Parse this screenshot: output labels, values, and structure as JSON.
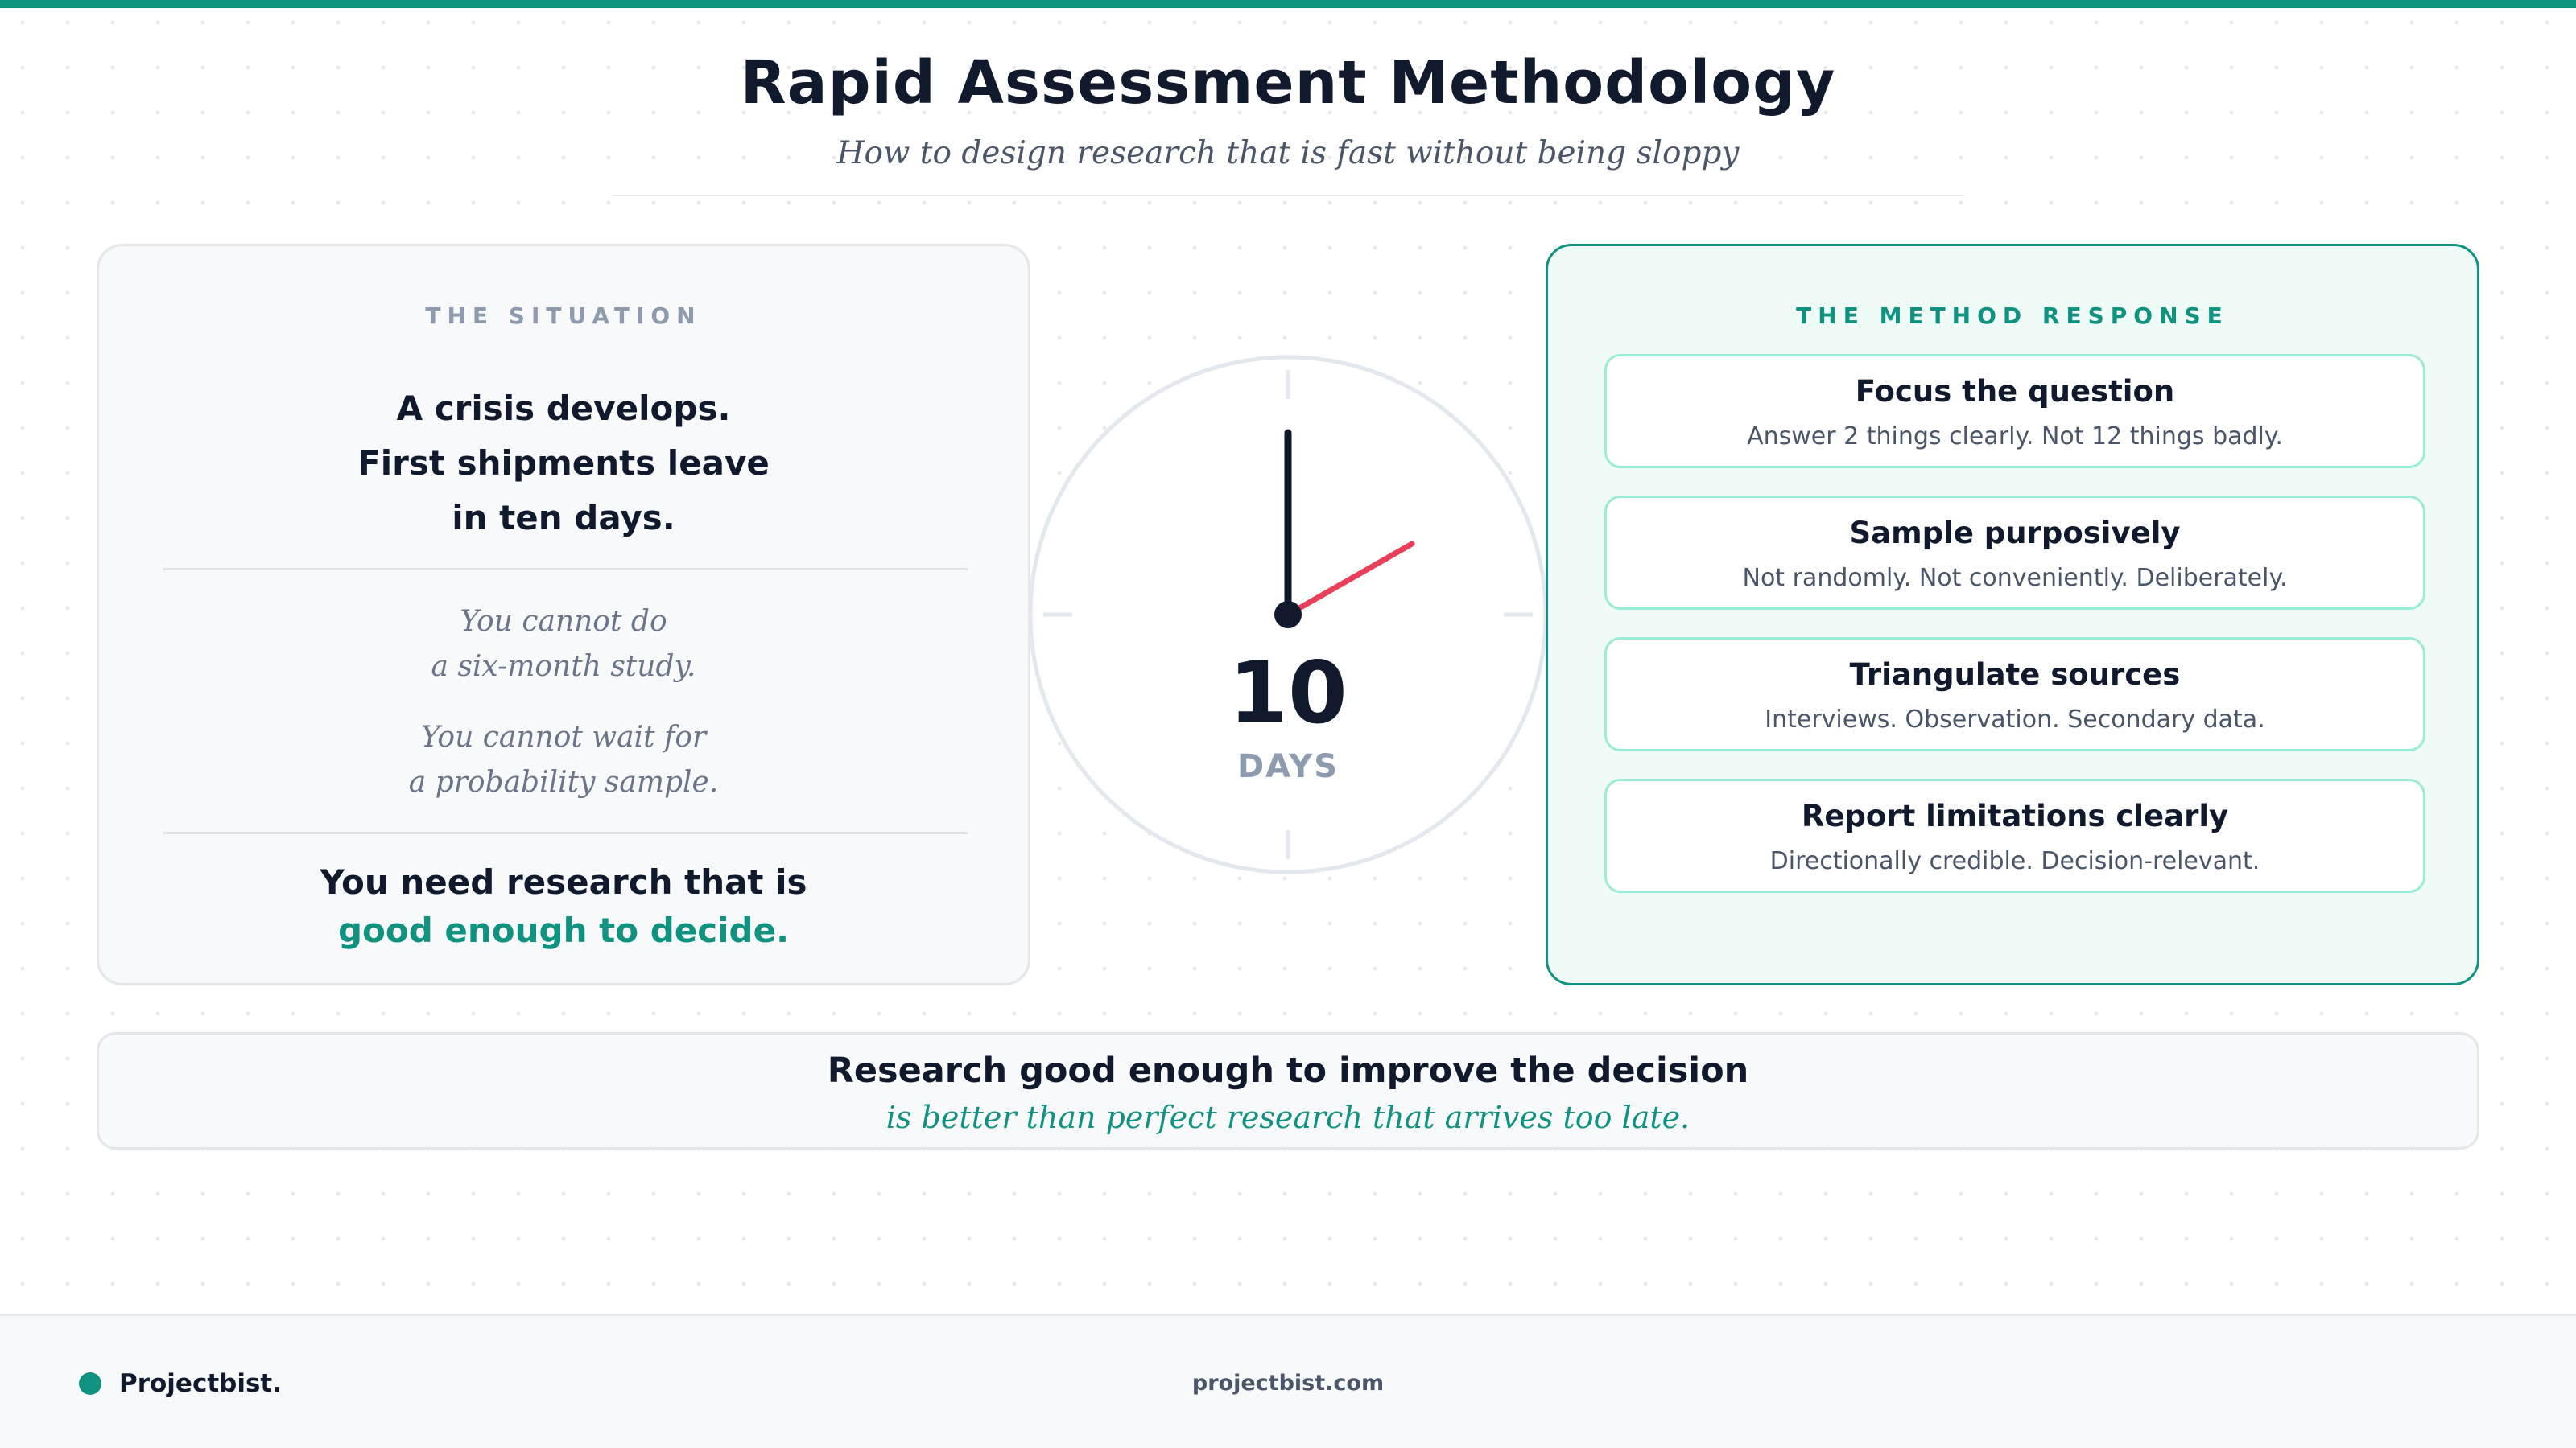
{
  "header": {
    "title": "Rapid Assessment Methodology",
    "subtitle": "How to design research that is fast without being sloppy"
  },
  "situation": {
    "kicker": "THE SITUATION",
    "headline_lines": [
      "A crisis develops.",
      "First shipments leave",
      "in ten days."
    ],
    "constraint_1_lines": [
      "You cannot do",
      "a six-month study."
    ],
    "constraint_2_lines": [
      "You cannot wait for",
      "a probability sample."
    ],
    "need_line_1": "You need research that is",
    "need_line_2": "good enough to decide."
  },
  "clock": {
    "number": "10",
    "unit": "DAYS"
  },
  "method": {
    "kicker": "THE METHOD RESPONSE",
    "steps": [
      {
        "title": "Focus the question",
        "description": "Answer 2 things clearly. Not 12 things badly."
      },
      {
        "title": "Sample purposively",
        "description": "Not randomly. Not conveniently. Deliberately."
      },
      {
        "title": "Triangulate sources",
        "description": "Interviews. Observation. Secondary data."
      },
      {
        "title": "Report limitations clearly",
        "description": "Directionally credible. Decision-relevant."
      }
    ]
  },
  "banner": {
    "main": "Research good enough to improve the decision",
    "sub": "is better than perfect research that arrives too late."
  },
  "footer": {
    "brand": "Projectbist.",
    "url": "projectbist.com"
  },
  "colors": {
    "accent": "#0f9280",
    "ink": "#111a2c",
    "muted": "#8e9aad",
    "clock_second_hand": "#e8405a"
  }
}
